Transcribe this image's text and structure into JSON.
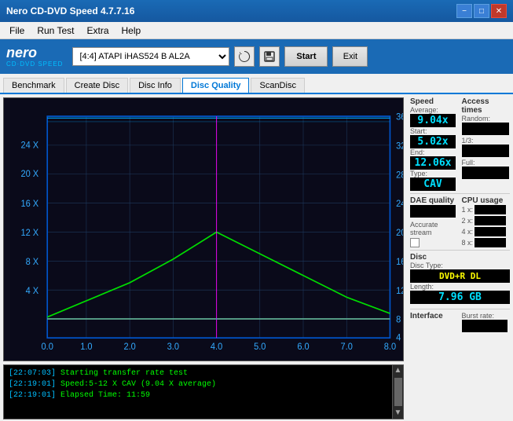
{
  "app": {
    "title": "Nero CD-DVD Speed 4.7.7.16",
    "menu": {
      "items": [
        "File",
        "Run Test",
        "Extra",
        "Help"
      ]
    },
    "toolbar": {
      "drive_select": "[4:4]  ATAPI iHAS524  B AL2A",
      "start_label": "Start",
      "exit_label": "Exit"
    },
    "tabs": [
      {
        "label": "Benchmark",
        "active": false
      },
      {
        "label": "Create Disc",
        "active": false
      },
      {
        "label": "Disc Info",
        "active": false
      },
      {
        "label": "Disc Quality",
        "active": true
      },
      {
        "label": "ScanDisc",
        "active": false
      }
    ]
  },
  "right_panel": {
    "speed": {
      "title": "Speed",
      "average_label": "Average:",
      "average_value": "9.04x",
      "start_label": "Start:",
      "start_value": "5.02x",
      "end_label": "End:",
      "end_value": "12.06x",
      "type_label": "Type:",
      "type_value": "CAV"
    },
    "access_times": {
      "title": "Access times",
      "random_label": "Random:",
      "random_value": "",
      "one_third_label": "1/3:",
      "one_third_value": "",
      "full_label": "Full:",
      "full_value": ""
    },
    "cpu_usage": {
      "title": "CPU usage",
      "x1_label": "1 x:",
      "x1_value": "",
      "x2_label": "2 x:",
      "x2_value": "",
      "x4_label": "4 x:",
      "x4_value": "",
      "x8_label": "8 x:",
      "x8_value": ""
    },
    "dae_quality": {
      "title": "DAE quality",
      "value": ""
    },
    "accurate_stream": {
      "title": "Accurate stream",
      "checked": false
    },
    "disc": {
      "type_label": "Disc Type:",
      "type_value": "DVD+R DL",
      "length_label": "Length:",
      "length_value": "7.96 GB"
    },
    "interface": {
      "title": "Interface",
      "burst_label": "Burst rate:",
      "burst_value": ""
    }
  },
  "chart": {
    "left_axis": [
      "24 X",
      "20 X",
      "16 X",
      "12 X",
      "8 X",
      "4 X"
    ],
    "right_axis": [
      "36",
      "32",
      "28",
      "24",
      "20",
      "16",
      "12",
      "8",
      "4"
    ],
    "bottom_axis": [
      "0.0",
      "1.0",
      "2.0",
      "3.0",
      "4.0",
      "5.0",
      "6.0",
      "7.0",
      "8.0"
    ]
  },
  "log": {
    "entries": [
      {
        "time": "22:07:03",
        "message": "Starting transfer rate test"
      },
      {
        "time": "22:19:01",
        "message": "Speed:5-12 X CAV (9.04 X average)"
      },
      {
        "time": "22:19:01",
        "message": "Elapsed Time: 11:59"
      }
    ]
  }
}
